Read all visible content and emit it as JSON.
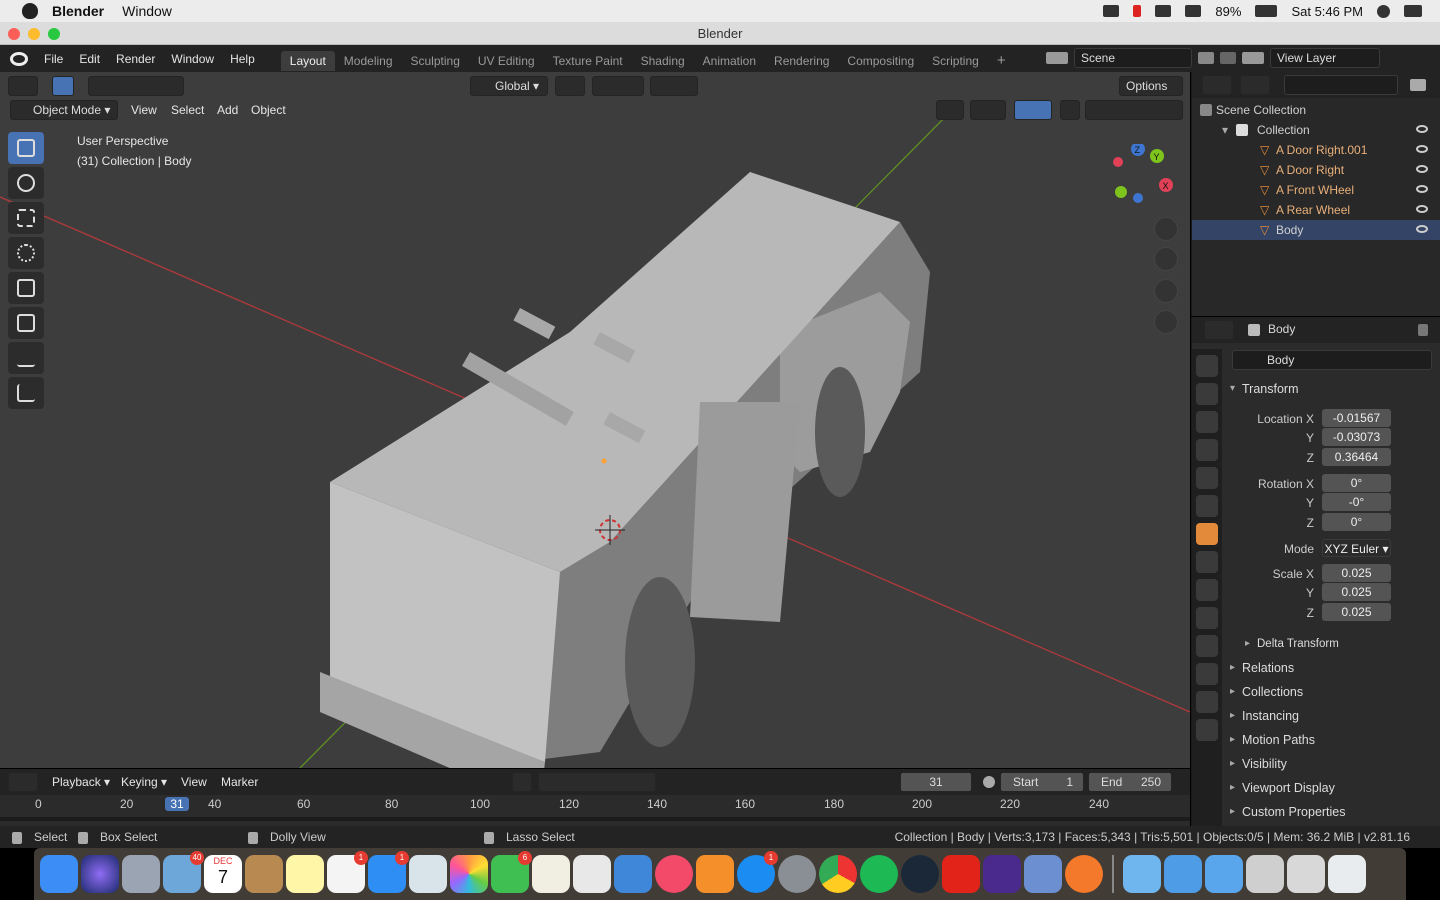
{
  "mac_menubar": {
    "app_name": "Blender",
    "menu": [
      "Window"
    ],
    "battery": "89%",
    "clock": "Sat 5:46 PM"
  },
  "window": {
    "title": "Blender"
  },
  "topbar": {
    "menu": [
      "File",
      "Edit",
      "Render",
      "Window",
      "Help"
    ],
    "workspaces": [
      "Layout",
      "Modeling",
      "Sculpting",
      "UV Editing",
      "Texture Paint",
      "Shading",
      "Animation",
      "Rendering",
      "Compositing",
      "Scripting"
    ],
    "active_workspace": "Layout",
    "scene": "Scene",
    "view_layer": "View Layer"
  },
  "viewport": {
    "mode": "Object Mode",
    "menus": [
      "View",
      "Select",
      "Add",
      "Object"
    ],
    "transform_orientation": "Global",
    "options": "Options",
    "overlay_text": [
      "User Perspective",
      "(31) Collection | Body"
    ],
    "gizmo_axes": [
      "Z",
      "Y",
      "X"
    ]
  },
  "outliner": {
    "root": "Scene Collection",
    "collection": "Collection",
    "items": [
      "A Door Right.001",
      "A Door Right",
      "A Front WHeel",
      "A Rear Wheel",
      "Body"
    ]
  },
  "properties": {
    "object_name": "Body",
    "data_name": "Body",
    "transform_header": "Transform",
    "location": {
      "label_x": "Location X",
      "x": "-0.01567",
      "y": "-0.03073",
      "z": "0.36464"
    },
    "rotation": {
      "label_x": "Rotation X",
      "x": "0°",
      "y": "-0°",
      "z": "0°"
    },
    "mode_label": "Mode",
    "mode_value": "XYZ Euler",
    "scale": {
      "label_x": "Scale X",
      "x": "0.025",
      "y": "0.025",
      "z": "0.025"
    },
    "axis_labels": [
      "Y",
      "Z"
    ],
    "delta": "Delta Transform",
    "sections": [
      "Relations",
      "Collections",
      "Instancing",
      "Motion Paths",
      "Visibility",
      "Viewport Display",
      "Custom Properties"
    ]
  },
  "timeline": {
    "menus": [
      "Playback",
      "Keying",
      "View",
      "Marker"
    ],
    "current_frame": "31",
    "start_label": "Start",
    "start": "1",
    "end_label": "End",
    "end": "250",
    "ruler": [
      "0",
      "20",
      "31",
      "40",
      "60",
      "80",
      "100",
      "120",
      "140",
      "160",
      "180",
      "200",
      "220",
      "240"
    ]
  },
  "statusbar": {
    "select": "Select",
    "box_select": "Box Select",
    "dolly": "Dolly View",
    "lasso": "Lasso Select",
    "stats": "Collection | Body | Verts:3,173 | Faces:5,343 | Tris:5,501 | Objects:0/5 | Mem: 36.2 MiB | v2.81.16"
  },
  "dock": {
    "badges": [
      "40",
      "1",
      "1",
      "6",
      "1"
    ],
    "calendar_month": "DEC",
    "calendar_day": "7"
  },
  "colors": {
    "accent": "#4772b3",
    "grid_x": "#c0393b",
    "grid_y": "#6e9a2a",
    "mesh": "#c9c9c9"
  }
}
